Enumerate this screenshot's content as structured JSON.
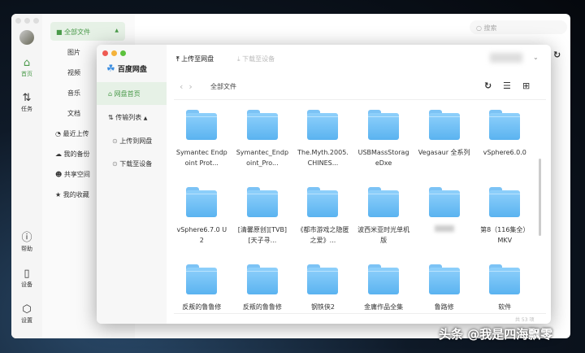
{
  "back_window": {
    "rail": [
      {
        "label": "首页",
        "icon": "home-icon"
      },
      {
        "label": "任务",
        "icon": "transfer-icon"
      },
      {
        "label": "帮助",
        "icon": "help-icon"
      },
      {
        "label": "设备",
        "icon": "device-icon"
      },
      {
        "label": "设置",
        "icon": "settings-icon"
      }
    ],
    "nav": {
      "all_files": "全部文件",
      "sub": [
        "图片",
        "视频",
        "音乐",
        "文档"
      ],
      "items": [
        {
          "label": "最近上传",
          "icon": "clock-icon"
        },
        {
          "label": "我的备份",
          "icon": "cloud-icon"
        },
        {
          "label": "共享空间",
          "icon": "users-icon"
        },
        {
          "label": "我的收藏",
          "icon": "star-icon"
        }
      ]
    },
    "search_placeholder": "搜索"
  },
  "front_window": {
    "app_name": "百度网盘",
    "sidebar": {
      "home": "网盘首页",
      "transfer": "传输列表",
      "upload": "上传到网盘",
      "download": "下载至设备"
    },
    "toolbar": {
      "upload": "上传至网盘",
      "download": "下载至设备"
    },
    "breadcrumb": "全部文件",
    "files": [
      "Symantec Endpoint Prot...",
      "Symantec_Endpoint_Pro...",
      "The.Myth.2005.CHINES...",
      "USBMassStorageDxe",
      "Vegasaur 全系列",
      "vSphere6.0.0",
      "vSphere6.7.0 U2",
      "[清馨原创][TVB][天子寻...",
      "《都市游戏之隐匿之爱》...",
      "波西米亚时光单机版",
      "",
      "第8（116集全）MKV",
      "反叛的鲁鲁修",
      "反叛的鲁鲁修",
      "钢铁侠2",
      "金庸作品全集",
      "鲁路修",
      "软件"
    ],
    "footer": "共 53 项"
  },
  "watermark": "头条 @我是四海飘零",
  "colors": {
    "accent": "#4a9a4a",
    "folder": "#6cbcf3"
  }
}
